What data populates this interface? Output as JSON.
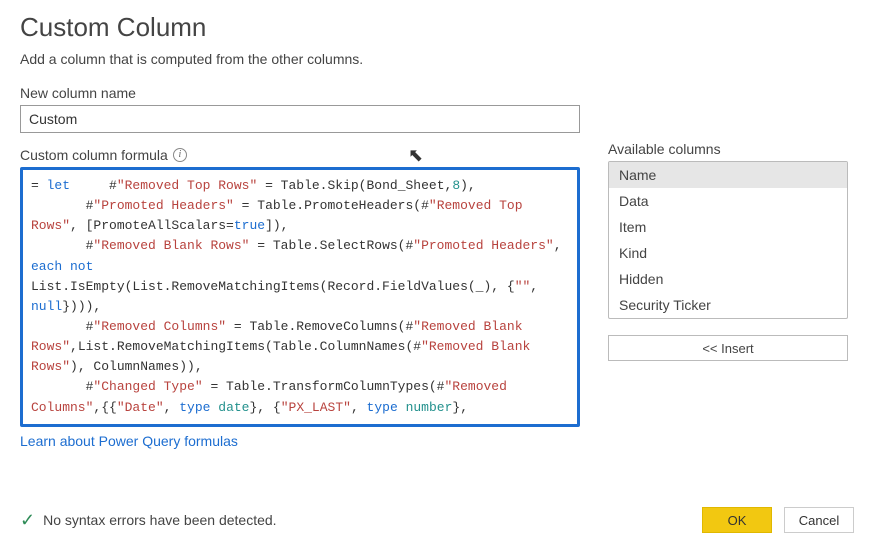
{
  "dialog": {
    "title": "Custom Column",
    "subtitle": "Add a column that is computed from the other columns."
  },
  "columnName": {
    "label": "New column name",
    "value": "Custom"
  },
  "formula": {
    "label": "Custom column formula",
    "tokens": [
      {
        "t": "= ",
        "c": ""
      },
      {
        "t": "let",
        "c": "kw"
      },
      {
        "t": "     #",
        "c": ""
      },
      {
        "t": "\"Removed Top Rows\"",
        "c": "str"
      },
      {
        "t": " = Table.Skip(Bond_Sheet,",
        "c": ""
      },
      {
        "t": "8",
        "c": "teal"
      },
      {
        "t": "),\n       #",
        "c": ""
      },
      {
        "t": "\"Promoted Headers\"",
        "c": "str"
      },
      {
        "t": " = Table.PromoteHeaders(#",
        "c": ""
      },
      {
        "t": "\"Removed Top Rows\"",
        "c": "str"
      },
      {
        "t": ", [PromoteAllScalars=",
        "c": ""
      },
      {
        "t": "true",
        "c": "kw"
      },
      {
        "t": "]),\n       #",
        "c": ""
      },
      {
        "t": "\"Removed Blank Rows\"",
        "c": "str"
      },
      {
        "t": " = Table.SelectRows(#",
        "c": ""
      },
      {
        "t": "\"Promoted Headers\"",
        "c": "str"
      },
      {
        "t": ", ",
        "c": ""
      },
      {
        "t": "each not",
        "c": "kw"
      },
      {
        "t": " List.IsEmpty(List.RemoveMatchingItems(Record.FieldValues(_), {",
        "c": ""
      },
      {
        "t": "\"\"",
        "c": "str"
      },
      {
        "t": ", ",
        "c": ""
      },
      {
        "t": "null",
        "c": "kw"
      },
      {
        "t": "}))),\n       #",
        "c": ""
      },
      {
        "t": "\"Removed Columns\"",
        "c": "str"
      },
      {
        "t": " = Table.RemoveColumns(#",
        "c": ""
      },
      {
        "t": "\"Removed Blank Rows\"",
        "c": "str"
      },
      {
        "t": ",List.RemoveMatchingItems(Table.ColumnNames(#",
        "c": ""
      },
      {
        "t": "\"Removed Blank Rows\"",
        "c": "str"
      },
      {
        "t": "), ColumnNames)),\n       #",
        "c": ""
      },
      {
        "t": "\"Changed Type\"",
        "c": "str"
      },
      {
        "t": " = Table.TransformColumnTypes(#",
        "c": ""
      },
      {
        "t": "\"Removed Columns\"",
        "c": "str"
      },
      {
        "t": ",{{",
        "c": ""
      },
      {
        "t": "\"Date\"",
        "c": "str"
      },
      {
        "t": ", ",
        "c": ""
      },
      {
        "t": "type",
        "c": "kw"
      },
      {
        "t": " ",
        "c": ""
      },
      {
        "t": "date",
        "c": "teal"
      },
      {
        "t": "}, {",
        "c": ""
      },
      {
        "t": "\"PX_LAST\"",
        "c": "str"
      },
      {
        "t": ", ",
        "c": ""
      },
      {
        "t": "type",
        "c": "kw"
      },
      {
        "t": " ",
        "c": ""
      },
      {
        "t": "number",
        "c": "teal"
      },
      {
        "t": "},",
        "c": ""
      }
    ],
    "learnLink": "Learn about Power Query formulas"
  },
  "available": {
    "label": "Available columns",
    "items": [
      {
        "label": "Name",
        "selected": true
      },
      {
        "label": "Data",
        "selected": false
      },
      {
        "label": "Item",
        "selected": false
      },
      {
        "label": "Kind",
        "selected": false
      },
      {
        "label": "Hidden",
        "selected": false
      },
      {
        "label": "Security Ticker",
        "selected": false
      }
    ],
    "insertLabel": "<< Insert"
  },
  "status": {
    "message": "No syntax errors have been detected."
  },
  "buttons": {
    "ok": "OK",
    "cancel": "Cancel"
  }
}
